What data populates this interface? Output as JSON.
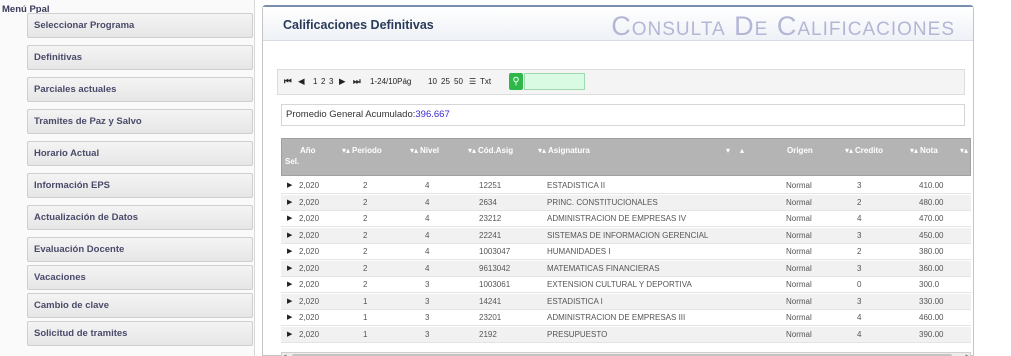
{
  "sidebar": {
    "title": "Menú Ppal",
    "items": [
      {
        "label": "Seleccionar Programa"
      },
      {
        "label": "Definitivas"
      },
      {
        "label": "Parciales actuales"
      },
      {
        "label": "Tramites de Paz y Salvo"
      },
      {
        "label": "Horario Actual"
      },
      {
        "label": "Información EPS"
      },
      {
        "label": "Actualización de Datos"
      },
      {
        "label": "Evaluación Docente"
      },
      {
        "label": "Vacaciones"
      },
      {
        "label": "Cambio de clave"
      },
      {
        "label": "Solicitud de tramites"
      }
    ]
  },
  "panel": {
    "title": "Calificaciones Definitivas",
    "banner": "Consulta De Calificaciones"
  },
  "toolbar": {
    "first_icon": "⏮",
    "prev_icon": "◀",
    "pages": [
      "1",
      "2",
      "3"
    ],
    "next_icon": "▶",
    "last_icon": "⏭",
    "range_text": "1-24/10Pág",
    "page_sizes": [
      "10",
      "25",
      "50"
    ],
    "txt_label": "Txt",
    "search_placeholder": ""
  },
  "promedio": {
    "label": "Promedio General Acumulado:",
    "value": "396.667"
  },
  "grid": {
    "columns": {
      "sel": "Sel.",
      "anio": "Año",
      "periodo": "Periodo",
      "nivel": "Nivel",
      "cod_asig": "Cód.Asig",
      "asignatura": "Asignatura",
      "origen": "Origen",
      "credito": "Credito",
      "nota": "Nota"
    },
    "sort_marker": "▾▴",
    "rows": [
      {
        "anio": "2,020",
        "periodo": "2",
        "nivel": "4",
        "cod": "12251",
        "asignatura": "ESTADISTICA II",
        "origen": "Normal",
        "credito": "3",
        "nota": "410.00"
      },
      {
        "anio": "2,020",
        "periodo": "2",
        "nivel": "4",
        "cod": "2634",
        "asignatura": "PRINC. CONSTITUCIONALES",
        "origen": "Normal",
        "credito": "2",
        "nota": "480.00"
      },
      {
        "anio": "2,020",
        "periodo": "2",
        "nivel": "4",
        "cod": "23212",
        "asignatura": "ADMINISTRACION DE EMPRESAS IV",
        "origen": "Normal",
        "credito": "4",
        "nota": "470.00"
      },
      {
        "anio": "2,020",
        "periodo": "2",
        "nivel": "4",
        "cod": "22241",
        "asignatura": "SISTEMAS DE INFORMACION GERENCIAL",
        "origen": "Normal",
        "credito": "3",
        "nota": "450.00"
      },
      {
        "anio": "2,020",
        "periodo": "2",
        "nivel": "4",
        "cod": "1003047",
        "asignatura": "HUMANIDADES I",
        "origen": "Normal",
        "credito": "2",
        "nota": "380.00"
      },
      {
        "anio": "2,020",
        "periodo": "2",
        "nivel": "4",
        "cod": "9613042",
        "asignatura": "MATEMATICAS FINANCIERAS",
        "origen": "Normal",
        "credito": "3",
        "nota": "360.00"
      },
      {
        "anio": "2,020",
        "periodo": "2",
        "nivel": "3",
        "cod": "1003061",
        "asignatura": "EXTENSION CULTURAL Y DEPORTIVA",
        "origen": "Normal",
        "credito": "0",
        "nota": "300.0"
      },
      {
        "anio": "2,020",
        "periodo": "1",
        "nivel": "3",
        "cod": "14241",
        "asignatura": "ESTADISTICA I",
        "origen": "Normal",
        "credito": "3",
        "nota": "330.00"
      },
      {
        "anio": "2,020",
        "periodo": "1",
        "nivel": "3",
        "cod": "23201",
        "asignatura": "ADMINISTRACION DE EMPRESAS III",
        "origen": "Normal",
        "credito": "4",
        "nota": "460.00"
      },
      {
        "anio": "2,020",
        "periodo": "1",
        "nivel": "3",
        "cod": "2192",
        "asignatura": "PRESUPUESTO",
        "origen": "Normal",
        "credito": "4",
        "nota": "390.00"
      }
    ]
  },
  "colors": {
    "grid_header_bg": "#b4b4b4",
    "promedio_value": "#3a2ad0",
    "search_button": "#2fb84a",
    "banner": "#b4b6d6"
  }
}
